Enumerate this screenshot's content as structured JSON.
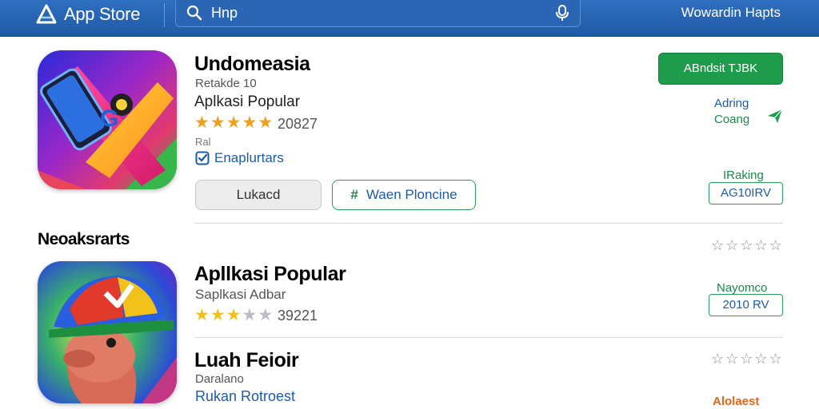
{
  "header": {
    "app_name": "App Store",
    "search_value": "Hnp",
    "right_link": "Wowardin Hapts"
  },
  "featured": {
    "title": "Undomeasia",
    "subtitle": "Retakde 10",
    "category": "Aplkasi Popular",
    "rating_stars": 5,
    "rating_count": "20827",
    "note": "Ral",
    "badge": "Enaplurtars",
    "button_grey": "Lukacd",
    "button_outline_hash": "#",
    "button_outline": "Waen Ploncine",
    "button_green": "ABndsit TJBK",
    "side_line_1": "Adring",
    "side_line_2": "Coang",
    "ranking_label": "IRaking",
    "ranking_value": "AG10IRV"
  },
  "section": {
    "title": "Neoaksrarts"
  },
  "popular": {
    "title": "Apllkasi Popular",
    "subtitle": "Saplkasi Adbar",
    "rating_stars": 3.5,
    "rating_count": "39221",
    "tag_label": "Nayomco",
    "tag_value": "2010 RV"
  },
  "third": {
    "title": "Luah Feioir",
    "subtitle": "Daralano",
    "link": "Rukan Rotroest",
    "orange_label": "Alolaest"
  },
  "colors": {
    "topbar": "#1f5aa6",
    "accent_green": "#1e9c4c",
    "link_blue": "#1f5aa6",
    "star_gold": "#f1a01b",
    "orange": "#e2651a"
  }
}
